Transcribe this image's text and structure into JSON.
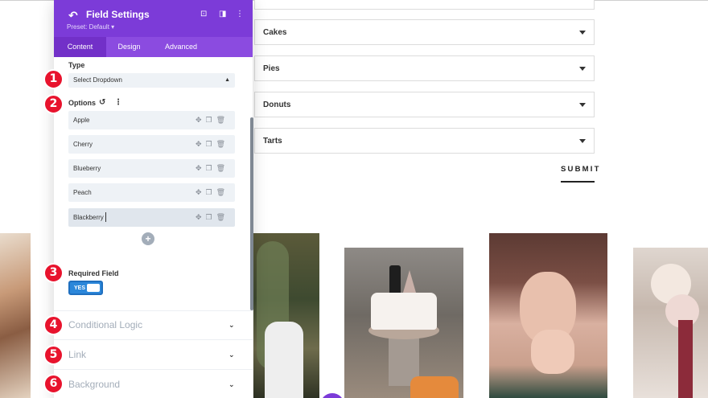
{
  "form": {
    "dropdowns": [
      {
        "label": "Cakes"
      },
      {
        "label": "Pies"
      },
      {
        "label": "Donuts"
      },
      {
        "label": "Tarts"
      }
    ],
    "submit_label": "SUBMIT"
  },
  "panel": {
    "title": "Field Settings",
    "preset": "Preset: Default ▾",
    "icons": {
      "back": "undo-icon",
      "focus": "target-icon",
      "split": "split-view-icon",
      "menu": "kebab-icon"
    },
    "tabs": [
      {
        "label": "Content",
        "active": true
      },
      {
        "label": "Design",
        "active": false
      },
      {
        "label": "Advanced",
        "active": false
      }
    ],
    "type_label": "Type",
    "type_value": "Select Dropdown",
    "options_label": "Options",
    "options": [
      {
        "label": "Apple"
      },
      {
        "label": "Cherry"
      },
      {
        "label": "Blueberry"
      },
      {
        "label": "Peach"
      },
      {
        "label": "Blackberry"
      }
    ],
    "add_symbol": "+",
    "required_label": "Required Field",
    "toggle_value": "YES",
    "groups": [
      {
        "label": "Conditional Logic"
      },
      {
        "label": "Link"
      },
      {
        "label": "Background"
      }
    ]
  },
  "badges": [
    "1",
    "2",
    "3",
    "4",
    "5",
    "6"
  ],
  "colors": {
    "accent": "#7c3bd8",
    "badge": "#e8132d",
    "toggle": "#2b87da"
  }
}
